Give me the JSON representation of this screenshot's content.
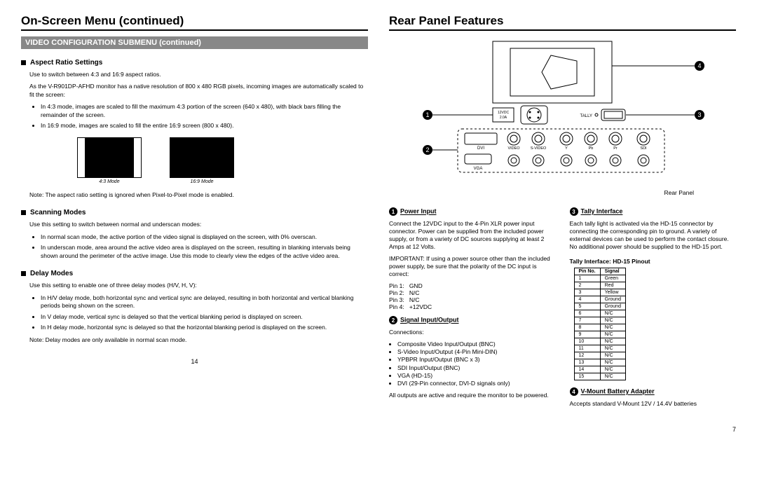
{
  "left": {
    "title": "On-Screen Menu (continued)",
    "submenu": "VIDEO CONFIGURATION SUBMENU (continued)",
    "aspect": {
      "heading": "Aspect Ratio Settings",
      "p1": "Use to switch between 4:3 and 16:9 aspect ratios.",
      "p2": "As the V-R901DP-AFHD monitor has a native resolution of 800 x 480 RGB pixels, incoming images are automatically scaled to fit the screen:",
      "b1": "In 4:3 mode, images are scaled to fill the maximum 4:3 portion of the screen (640 x 480), with black bars filling the remainder of the screen.",
      "b2": "In 16:9 mode, images are scaled to fill the entire 16:9 screen (800 x 480).",
      "cap43": "4:3 Mode",
      "cap169": "16:9 Mode",
      "note": "Note: The aspect ratio setting is ignored when Pixel-to-Pixel mode is enabled."
    },
    "scan": {
      "heading": "Scanning Modes",
      "p1": "Use this setting to switch between normal and underscan modes:",
      "b1": "In normal scan mode, the active portion of the video signal is displayed on the screen, with 0% overscan.",
      "b2": "In underscan mode, area around the active video area is displayed on the screen, resulting in blanking intervals being shown around the perimeter of the active image. Use this mode to clearly view the edges of the active video area."
    },
    "delay": {
      "heading": "Delay Modes",
      "p1": "Use this setting to enable one of three delay modes (H/V, H, V):",
      "b1": "In H/V delay mode, both horizontal sync and vertical sync are delayed, resulting in both horizontal and vertical blanking periods being shown on the screen.",
      "b2": "In V delay mode, vertical sync is delayed so that the vertical blanking period is displayed on screen.",
      "b3": "In H delay mode, horizontal sync is delayed so that the horizontal blanking period is displayed on the screen.",
      "note": "Note: Delay modes are only available in normal scan mode."
    },
    "pagenum": "14"
  },
  "right": {
    "title": "Rear Panel Features",
    "diagram": {
      "caption": "Rear Panel",
      "labels": {
        "dvi": "DVI",
        "vga": "VGA",
        "video": "VIDEO",
        "svideo": "S-VIDEO",
        "y": "Y",
        "pb": "Pb",
        "pr": "Pr",
        "sdi": "SDI",
        "tally": "TALLY",
        "pwr1": "12VDC",
        "pwr2": "2.0A"
      }
    },
    "f1": {
      "heading": "Power Input",
      "p1": "Connect the 12VDC input to the 4-Pin XLR power input connector. Power can be supplied from the included power supply, or from a variety of DC sources supplying at least 2 Amps at 12 Volts.",
      "p2": "IMPORTANT: If using a power source other than the included power supply, be sure that the polarity of the DC input is correct:",
      "pins": "Pin 1:   GND\nPin 2:   N/C\nPin 3:   N/C\nPin 4:   +12VDC"
    },
    "f2": {
      "heading": "Signal Input/Output",
      "p1": "Connections:",
      "c1": "Composite Video Input/Output (BNC)",
      "c2": "S-Video Input/Output (4-Pin Mini-DIN)",
      "c3": "YPBPR Input/Output (BNC x 3)",
      "c4": "SDI Input/Output (BNC)",
      "c5": "VGA (HD-15)",
      "c6": "DVI (29-Pin connector, DVI-D signals only)",
      "p2": "All outputs are active and require the monitor to be powered."
    },
    "f3": {
      "heading": "Tally Interface",
      "p1": "Each tally light is activated via the HD-15 connector by connecting the corresponding pin to ground. A variety of external devices can be used to perform the contact closure. No additional power should be supplied to the HD-15 port.",
      "table_title": "Tally Interface: HD-15 Pinout",
      "th1": "Pin No.",
      "th2": "Signal",
      "rows": [
        [
          "1",
          "Green"
        ],
        [
          "2",
          "Red"
        ],
        [
          "3",
          "Yellow"
        ],
        [
          "4",
          "Ground"
        ],
        [
          "5",
          "Ground"
        ],
        [
          "6",
          "N/C"
        ],
        [
          "7",
          "N/C"
        ],
        [
          "8",
          "N/C"
        ],
        [
          "9",
          "N/C"
        ],
        [
          "10",
          "N/C"
        ],
        [
          "11",
          "N/C"
        ],
        [
          "12",
          "N/C"
        ],
        [
          "13",
          "N/C"
        ],
        [
          "14",
          "N/C"
        ],
        [
          "15",
          "N/C"
        ]
      ]
    },
    "f4": {
      "heading": "V-Mount Battery Adapter",
      "p1": "Accepts standard V-Mount 12V / 14.4V batteries"
    },
    "pagenum": "7"
  }
}
